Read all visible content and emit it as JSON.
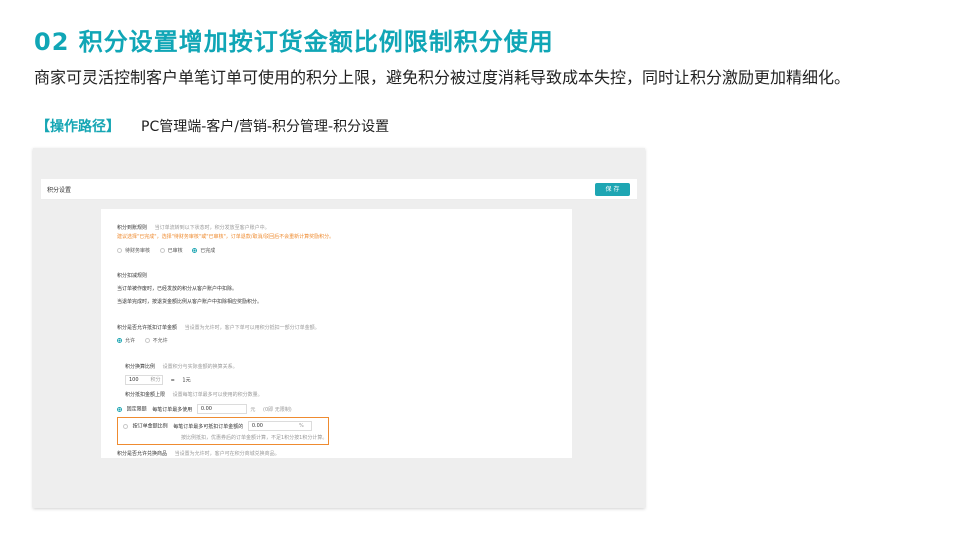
{
  "slide": {
    "title": "02  积分设置增加按订货金额比例限制积分使用",
    "subtitle": "商家可灵活控制客户单笔订单可使用的积分上限，避免积分被过度消耗导致成本失控，同时让积分激励更加精细化。",
    "path_label": "【操作路径】",
    "path_text": "PC管理端-客户/营销-积分管理-积分设置"
  },
  "panel": {
    "title": "积分设置",
    "save_label": "保 存"
  },
  "settings": {
    "arrival": {
      "label": "积分到账规则",
      "hint": "当订单流转到以下状态时，积分发放至客户账户中。",
      "warning": "建议选择\"已完成\"，选择\"待财务审核\"或\"已审核\"，订单退款/取消/驳回后不会重新计算奖励积分。",
      "options": [
        "待财务审核",
        "已审核",
        "已完成"
      ],
      "selected": "已完成"
    },
    "deduct": {
      "label": "积分扣减规则",
      "line1": "当订单被作废时，已经发放的积分从客户账户中扣除。",
      "line2": "当退单完成时，按退货金额比例从客户账户中扣除相应奖励积分。"
    },
    "offset": {
      "label": "积分是否允许抵扣订单金额",
      "hint": "当设置为允许时，客户下单可以用积分抵扣一部分订单金额。",
      "options": [
        "允许",
        "不允许"
      ],
      "selected": "允许"
    },
    "ratio": {
      "label": "积分换算比例",
      "hint": "设置积分与实际金额的换算关系。",
      "points_value": "100",
      "points_unit": "积分",
      "equals": "=",
      "money": "1元"
    },
    "limit": {
      "label": "积分抵扣金额上限",
      "hint": "设置每笔订单最多可以使用的积分数量。",
      "fixed_option": "固定限额",
      "fixed_text": "每笔订单最多使用",
      "fixed_value": "0.00",
      "fixed_unit": "元",
      "fixed_note": "(0即 无限制)",
      "ratio_option": "按订单金额比例",
      "ratio_text": "每笔订单最多可抵扣订单金额的",
      "ratio_value": "0.00",
      "ratio_unit": "%",
      "ratio_note": "按比例抵扣，优惠券后的订单金额计算，不足1积分按1积分计算。"
    },
    "exchange": {
      "label": "积分是否允许兑换商品",
      "hint": "当设置为允许时，客户可在积分商城兑换商品。"
    }
  }
}
